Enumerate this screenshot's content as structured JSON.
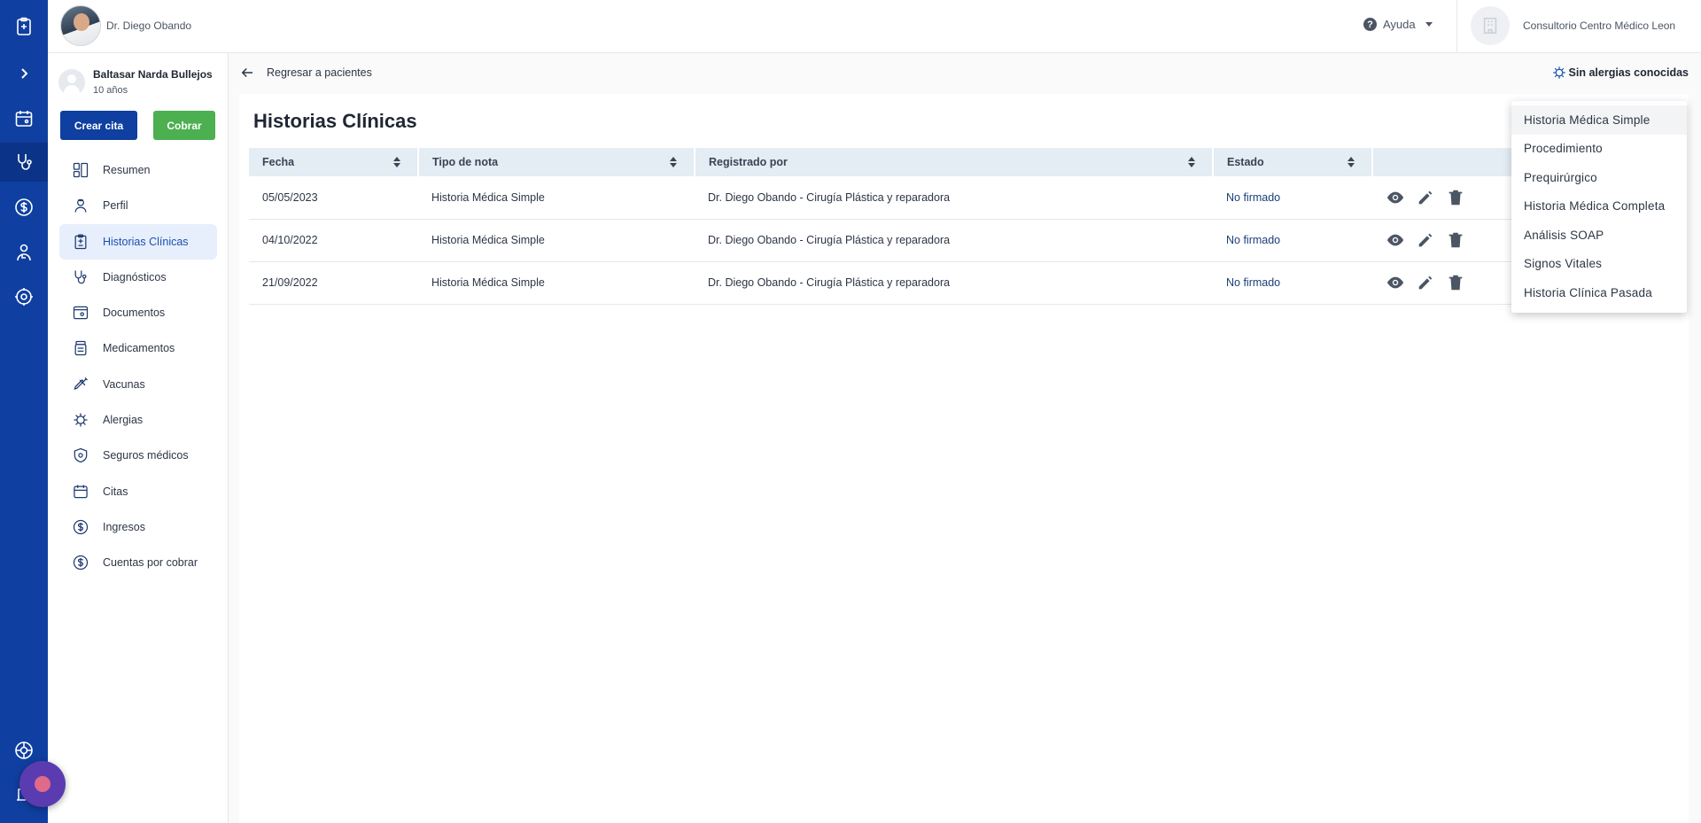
{
  "colors": {
    "rail": "#0f3fa0",
    "primary_button": "#0f3fa0",
    "success_button": "#4caf50",
    "active_nav_bg": "#e7effc",
    "table_header_bg": "#e4ecf4"
  },
  "rail": {
    "icons": [
      "clipboard-icon",
      "expand-chevron-icon",
      "calendar-icon",
      "stethoscope-icon",
      "dollar-icon",
      "doctor-icon",
      "settings-icon",
      "support-icon",
      "logout-icon"
    ]
  },
  "header": {
    "doctor_name": "Dr. Diego Obando",
    "help_label": "Ayuda",
    "clinic_name": "Consultorio Centro Médico Leon"
  },
  "patient": {
    "name": "Baltasar Narda Bullejos",
    "age": "10 años"
  },
  "actions": {
    "create_appointment": "Crear cita",
    "charge": "Cobrar"
  },
  "nav": {
    "items": [
      {
        "label": "Resumen",
        "icon": "dashboard-icon"
      },
      {
        "label": "Perfil",
        "icon": "profile-icon"
      },
      {
        "label": "Historias Clínicas",
        "icon": "clinical-history-icon"
      },
      {
        "label": "Diagnósticos",
        "icon": "stethoscope-icon"
      },
      {
        "label": "Documentos",
        "icon": "documents-icon"
      },
      {
        "label": "Medicamentos",
        "icon": "medication-icon"
      },
      {
        "label": "Vacunas",
        "icon": "syringe-icon"
      },
      {
        "label": "Alergias",
        "icon": "allergy-icon"
      },
      {
        "label": "Seguros médicos",
        "icon": "shield-icon"
      },
      {
        "label": "Citas",
        "icon": "calendar-icon"
      },
      {
        "label": "Ingresos",
        "icon": "dollar-icon"
      },
      {
        "label": "Cuentas por cobrar",
        "icon": "dollar-icon"
      }
    ]
  },
  "back": {
    "label": "Regresar a pacientes"
  },
  "allergy_badge": "Sin alergias conocidas",
  "main": {
    "title": "Historias Clínicas",
    "columns": [
      "Fecha",
      "Tipo de nota",
      "Registrado por",
      "Estado"
    ],
    "rows": [
      {
        "fecha": "05/05/2023",
        "tipo": "Historia Médica Simple",
        "registrado": "Dr. Diego Obando - Cirugía Plástica y reparadora",
        "estado": "No firmado"
      },
      {
        "fecha": "04/10/2022",
        "tipo": "Historia Médica Simple",
        "registrado": "Dr. Diego Obando - Cirugía Plástica y reparadora",
        "estado": "No firmado"
      },
      {
        "fecha": "21/09/2022",
        "tipo": "Historia Médica Simple",
        "registrado": "Dr. Diego Obando - Cirugía Plástica y reparadora",
        "estado": "No firmado"
      }
    ]
  },
  "dropdown": {
    "items": [
      "Historia Médica Simple",
      "Procedimiento",
      "Prequirúrgico",
      "Historia Médica Completa",
      "Análisis SOAP",
      "Signos Vitales",
      "Historia Clínica Pasada"
    ]
  }
}
